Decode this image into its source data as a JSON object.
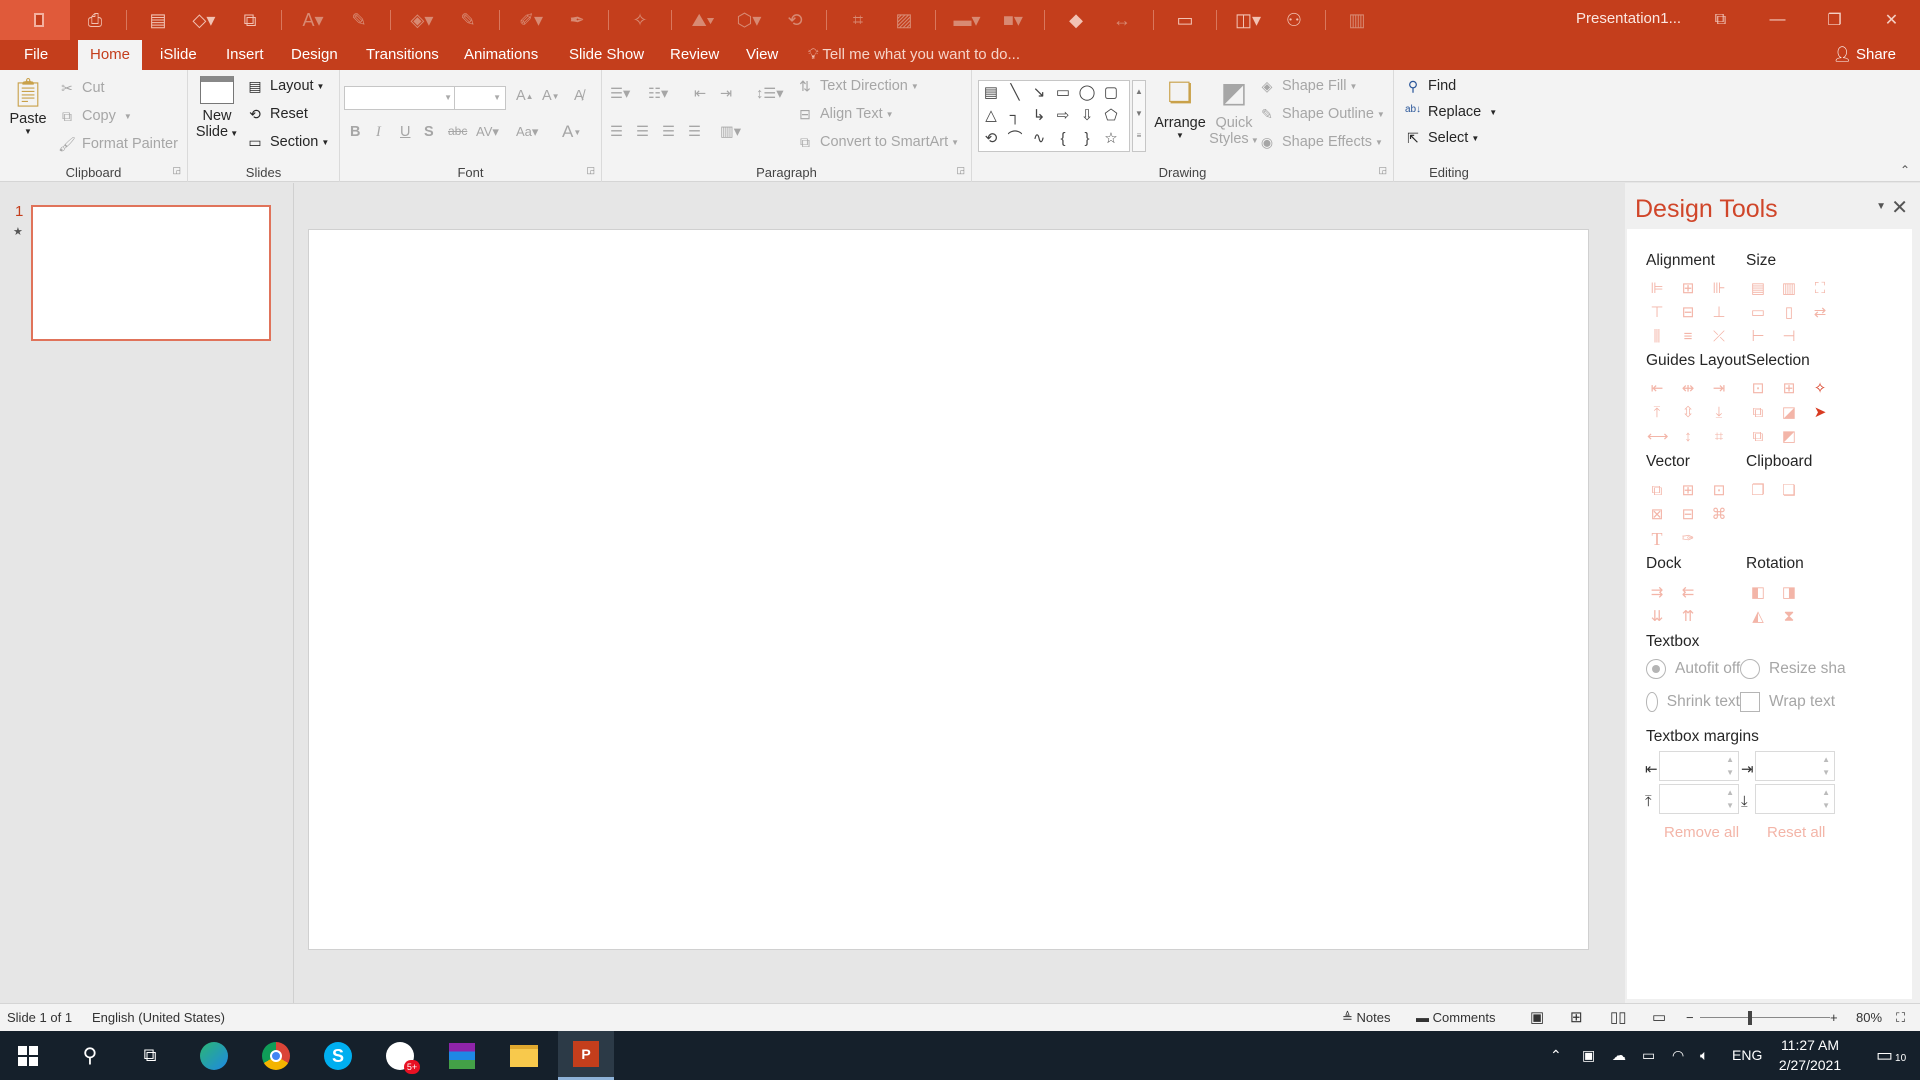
{
  "window": {
    "title": "Presentation1...",
    "controls": [
      "minimize",
      "maximize",
      "close"
    ]
  },
  "menu": {
    "tabs": [
      "File",
      "Home",
      "iSlide",
      "Insert",
      "Design",
      "Transitions",
      "Animations",
      "Slide Show",
      "Review",
      "View"
    ],
    "active_tab": "Home",
    "tell_me": "Tell me what you want to do...",
    "share": "Share"
  },
  "ribbon": {
    "clipboard": {
      "label": "Clipboard",
      "paste": "Paste",
      "cut": "Cut",
      "copy": "Copy",
      "format_painter": "Format Painter"
    },
    "slides": {
      "label": "Slides",
      "new_slide_1": "New",
      "new_slide_2": "Slide",
      "layout": "Layout",
      "reset": "Reset",
      "section": "Section"
    },
    "font": {
      "label": "Font"
    },
    "paragraph": {
      "label": "Paragraph",
      "text_direction": "Text Direction",
      "align_text": "Align Text",
      "convert_smartart": "Convert to SmartArt"
    },
    "drawing": {
      "label": "Drawing",
      "arrange": "Arrange",
      "quick_styles_1": "Quick",
      "quick_styles_2": "Styles",
      "shape_fill": "Shape Fill",
      "shape_outline": "Shape Outline",
      "shape_effects": "Shape Effects"
    },
    "editing": {
      "label": "Editing",
      "find": "Find",
      "replace": "Replace",
      "select": "Select"
    }
  },
  "thumbnails": {
    "slide_number": "1"
  },
  "design_tools": {
    "title": "Design Tools",
    "sections": {
      "alignment": "Alignment",
      "size": "Size",
      "guides_layout": "Guides Layout",
      "selection": "Selection",
      "vector": "Vector",
      "clipboard": "Clipboard",
      "dock": "Dock",
      "rotation": "Rotation",
      "textbox": "Textbox",
      "textbox_margins": "Textbox margins"
    },
    "textbox_options": {
      "autofit_off": "Autofit off",
      "resize_shape": "Resize sha",
      "shrink_text": "Shrink text",
      "wrap_text": "Wrap text"
    },
    "remove_all": "Remove all",
    "reset_all": "Reset all"
  },
  "status": {
    "slide": "Slide 1 of 1",
    "language": "English (United States)",
    "notes": "Notes",
    "comments": "Comments",
    "zoom": "80%"
  },
  "taskbar": {
    "language": "ENG",
    "time": "11:27 AM",
    "date": "2/27/2021",
    "notifications": "10"
  },
  "colors": {
    "accent": "#c43e1c",
    "pane_title": "#d0462a",
    "taskbar": "#15202b"
  }
}
